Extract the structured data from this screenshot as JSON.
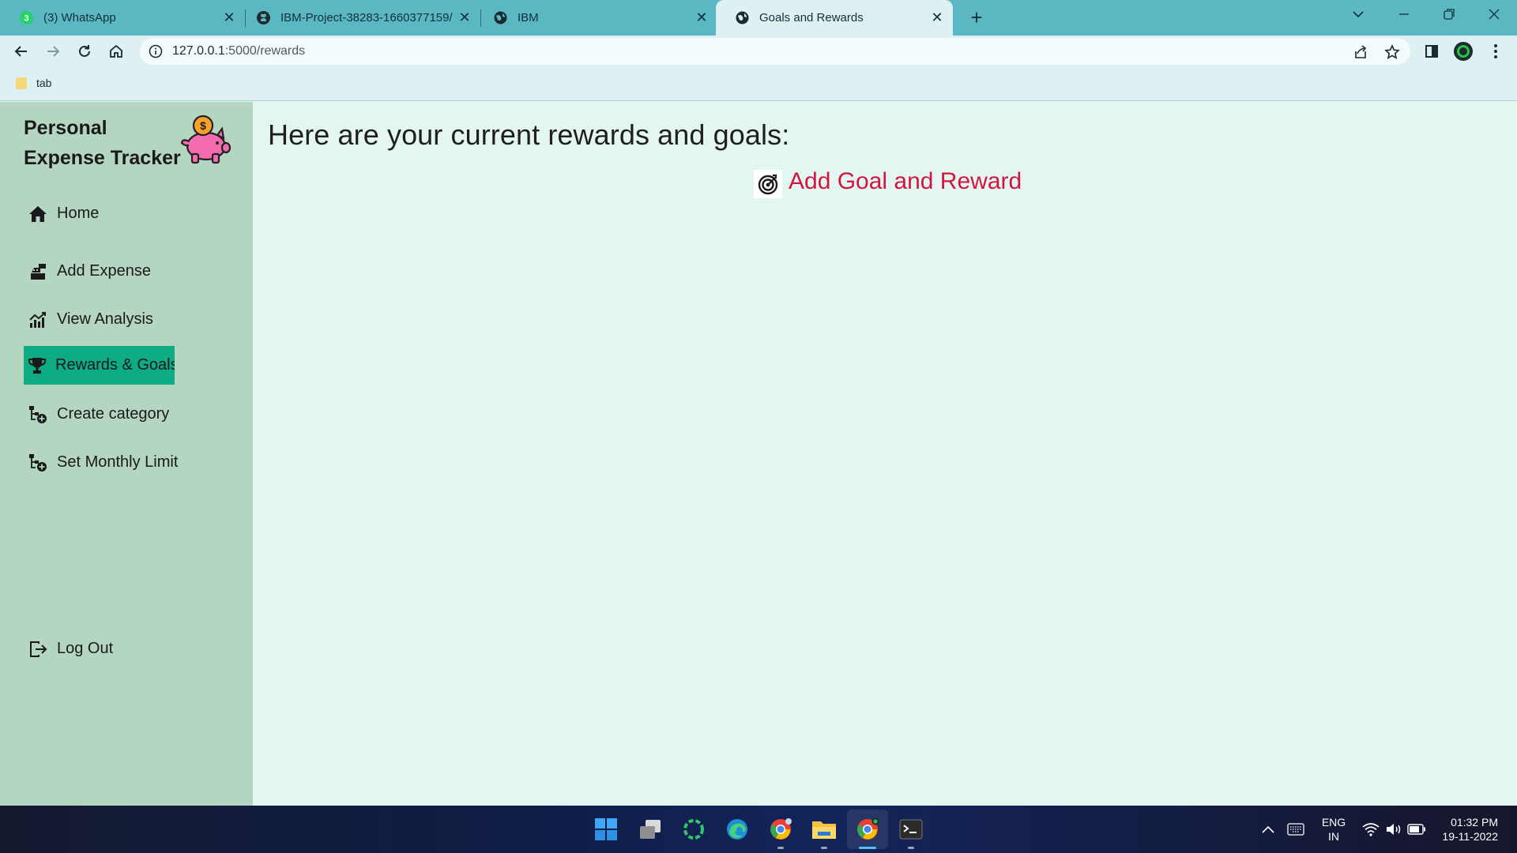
{
  "browser": {
    "tabs": [
      {
        "title": "(3) WhatsApp",
        "icon": "whatsapp-icon",
        "active": false
      },
      {
        "title": "IBM-Project-38283-1660377159/",
        "icon": "github-icon",
        "active": false
      },
      {
        "title": "IBM",
        "icon": "globe-icon",
        "active": false
      },
      {
        "title": "Goals and Rewards",
        "icon": "globe-icon",
        "active": true
      }
    ],
    "url_host": "127.0.0.1",
    "url_path": ":5000/rewards",
    "bookmark": "tab",
    "whatsapp_badge": "3"
  },
  "sidebar": {
    "brand_line1": "Personal",
    "brand_line2": "Expense Tracker",
    "items": [
      {
        "label": "Home",
        "icon": "home-icon"
      },
      {
        "label": "Add Expense",
        "icon": "cash-register-icon"
      },
      {
        "label": "View Analysis",
        "icon": "chart-icon"
      },
      {
        "label": "Rewards & Goals",
        "icon": "trophy-icon",
        "active": true
      },
      {
        "label": "Create category",
        "icon": "category-icon"
      },
      {
        "label": "Set Monthly Limit",
        "icon": "category-icon"
      }
    ],
    "logout": "Log Out"
  },
  "main": {
    "heading": "Here are your current rewards and goals:",
    "add_link": "Add Goal and Reward"
  },
  "taskbar": {
    "lang_line1": "ENG",
    "lang_line2": "IN",
    "time": "01:32 PM",
    "date": "19-11-2022"
  },
  "colors": {
    "tabbar": "#5bb8c3",
    "sidebar": "#b4d6c1",
    "main_bg": "#e4f6f1",
    "active_nav": "#0eac85",
    "link": "#d1163f"
  }
}
